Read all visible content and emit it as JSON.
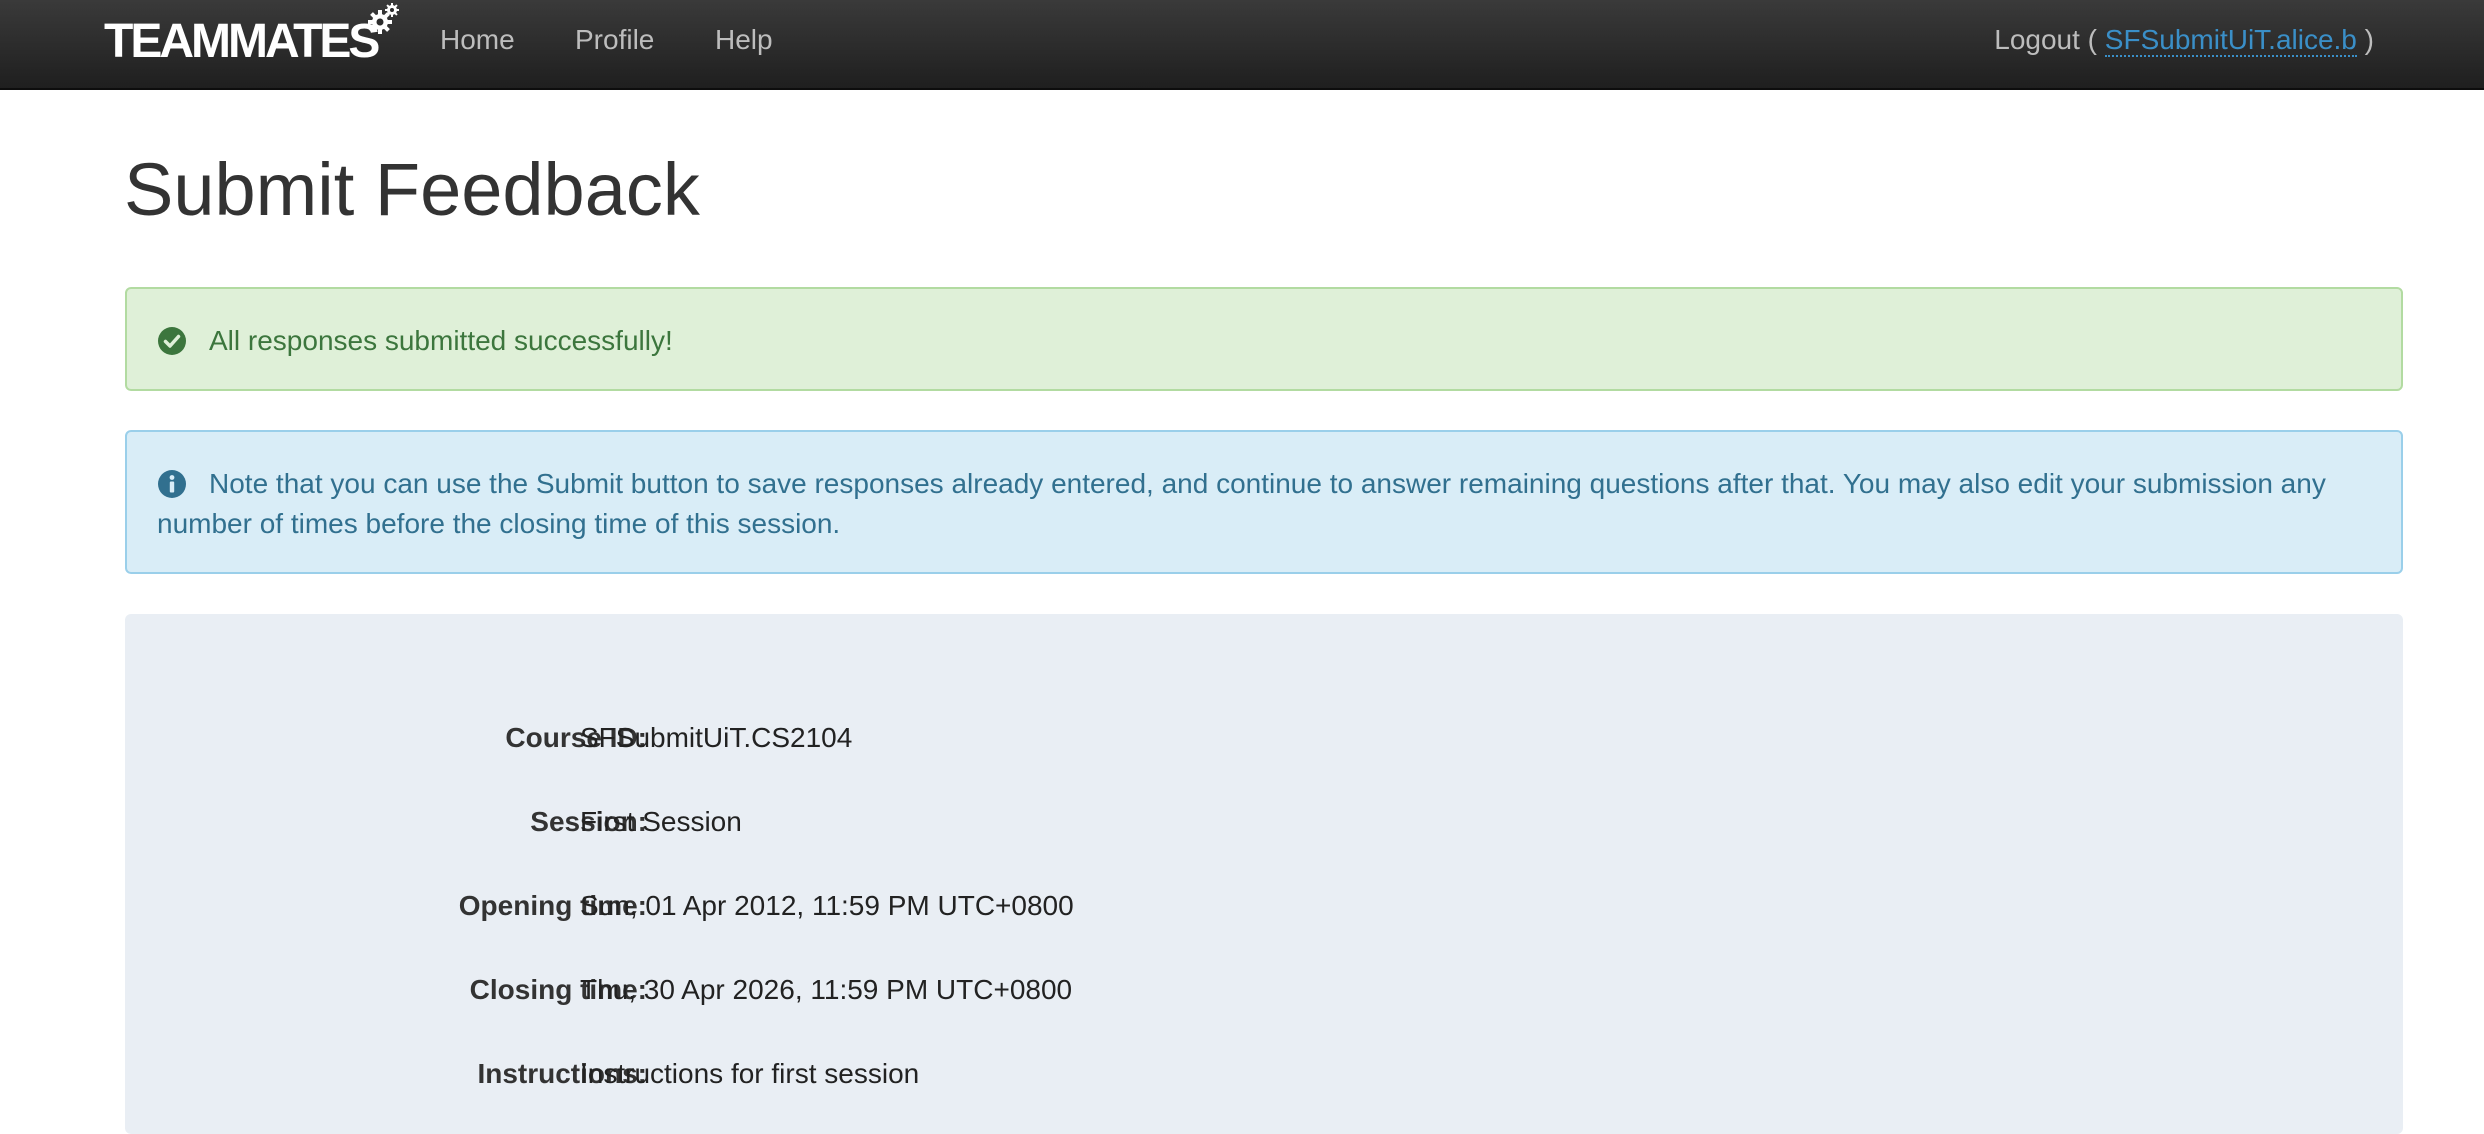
{
  "navbar": {
    "brand": "TEAMMATES",
    "links": [
      "Home",
      "Profile",
      "Help"
    ],
    "logout_prefix": "Logout (",
    "user_id": "SFSubmitUiT.alice.b",
    "logout_suffix": ")"
  },
  "page": {
    "title": "Submit Feedback"
  },
  "alerts": {
    "success": "All responses submitted successfully!",
    "info": "Note that you can use the Submit button to save responses already entered, and continue to answer remaining questions after that. You may also edit your submission any number of times before the closing time of this session."
  },
  "session_info": [
    {
      "label": "Course ID:",
      "value": "SFSubmitUiT.CS2104"
    },
    {
      "label": "Session:",
      "value": "First Session"
    },
    {
      "label": "Opening time:",
      "value": "Sun, 01 Apr 2012, 11:59 PM UTC+0800"
    },
    {
      "label": "Closing time:",
      "value": "Thu, 30 Apr 2026, 11:59 PM UTC+0800"
    },
    {
      "label": "Instructions:",
      "value": "Instructions for first session"
    }
  ],
  "colors": {
    "success_text": "#3c763d",
    "info_text": "#31708f",
    "link": "#3a8fc8"
  },
  "icons": {
    "success": "check-circle-icon",
    "info": "info-circle-icon",
    "brand": "gear-icon"
  }
}
